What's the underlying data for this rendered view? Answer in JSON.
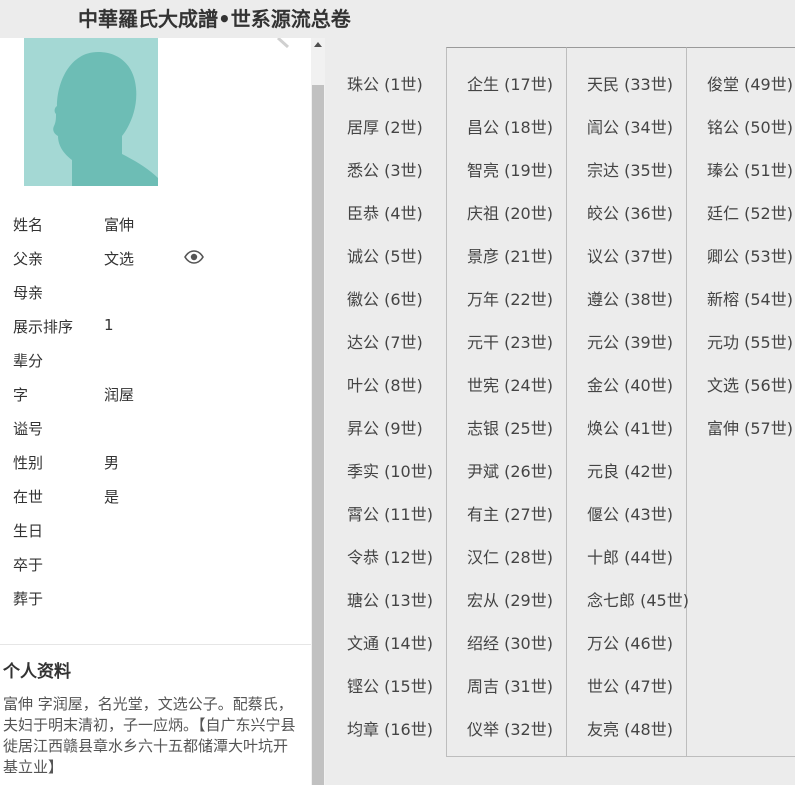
{
  "header": {
    "title": "中華羅氏大成譜•世系源流总卷"
  },
  "person": {
    "fields": [
      {
        "label": "姓名",
        "value": "富伸"
      },
      {
        "label": "父亲",
        "value": "文选"
      },
      {
        "label": "母亲",
        "value": ""
      },
      {
        "label": "展示排序",
        "value": "1"
      },
      {
        "label": "辈分",
        "value": ""
      },
      {
        "label": "字",
        "value": "润屋"
      },
      {
        "label": "谥号",
        "value": ""
      },
      {
        "label": "性别",
        "value": "男"
      },
      {
        "label": "在世",
        "value": "是"
      },
      {
        "label": "生日",
        "value": ""
      },
      {
        "label": "卒于",
        "value": ""
      },
      {
        "label": "葬于",
        "value": ""
      }
    ],
    "profile_title": "个人资料",
    "bio": "富伸 字润屋，名光堂，文选公子。配蔡氏，夫妇于明末清初，子一应炳。【自广东兴宁县徙居江西赣县章水乡六十五都储潭大叶坑开基立业】"
  },
  "colors": {
    "avatar_bg": "#a4d8d4",
    "silhouette": "#6dbdb5",
    "panel_bg": "#ececec"
  },
  "generations": [
    [
      "珠公 (1世)",
      "居厚 (2世)",
      "悉公 (3世)",
      "臣恭 (4世)",
      "诚公 (5世)",
      "徽公 (6世)",
      "达公 (7世)",
      "叶公 (8世)",
      "昇公 (9世)",
      "季实 (10世)",
      "霄公 (11世)",
      "令恭 (12世)",
      "瑭公 (13世)",
      "文通 (14世)",
      "铿公 (15世)",
      "均章 (16世)"
    ],
    [
      "企生 (17世)",
      "昌公 (18世)",
      "智亮 (19世)",
      "庆祖 (20世)",
      "景彦 (21世)",
      "万年 (22世)",
      "元干 (23世)",
      "世宪 (24世)",
      "志银 (25世)",
      "尹斌 (26世)",
      "有主 (27世)",
      "汉仁 (28世)",
      "宏从 (29世)",
      "绍经 (30世)",
      "周吉 (31世)",
      "仪举 (32世)"
    ],
    [
      "天民 (33世)",
      "訚公 (34世)",
      "宗达 (35世)",
      "皎公 (36世)",
      "议公 (37世)",
      "遵公 (38世)",
      "元公 (39世)",
      "金公 (40世)",
      "焕公 (41世)",
      "元良 (42世)",
      "偃公 (43世)",
      "十郎 (44世)",
      "念七郎 (45世)",
      "万公 (46世)",
      "世公 (47世)",
      "友亮 (48世)"
    ],
    [
      "俊堂 (49世)",
      "铭公 (50世)",
      "瑧公 (51世)",
      "廷仁 (52世)",
      "卿公 (53世)",
      "新榕 (54世)",
      "元功 (55世)",
      "文选 (56世)",
      "富伸 (57世)"
    ]
  ]
}
